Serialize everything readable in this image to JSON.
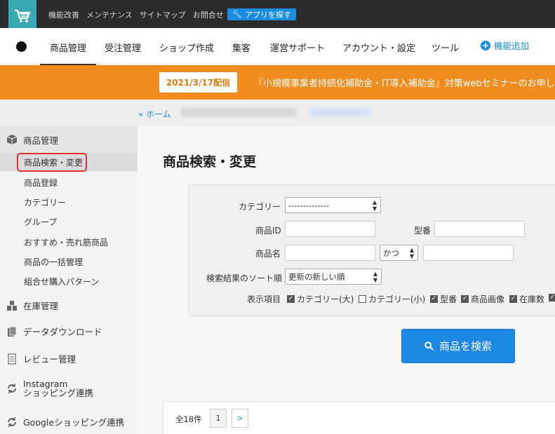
{
  "topbar": {
    "links": [
      "機能改善",
      "メンテナンス",
      "サイトマップ",
      "お問合せ"
    ],
    "app_button": "アプリを探す"
  },
  "mainnav": {
    "items": [
      "商品管理",
      "受注管理",
      "ショップ作成",
      "集客",
      "運営サポート",
      "アカウント・設定",
      "ツール"
    ],
    "add_label": "機能追加"
  },
  "banner": {
    "date": "2021/3/17配信",
    "text": "『小規模事業者持続化補助金・IT導入補助金』対策webセミナーのお申し込"
  },
  "breadcrumb": {
    "home": "« ホーム"
  },
  "sidebar": {
    "product_header": "商品管理",
    "product_items": [
      "商品検索・変更",
      "商品登録",
      "カテゴリー",
      "グループ",
      "おすすめ・売れ筋商品",
      "商品の一括管理",
      "組合せ購入パターン"
    ],
    "sections": [
      "在庫管理",
      "データダウンロード",
      "レビュー管理",
      "Instagram",
      "ショッピング連携",
      "Googleショッピング連携"
    ]
  },
  "page": {
    "title": "商品検索・変更"
  },
  "form": {
    "category_label": "カテゴリー",
    "category_value": "--------------",
    "product_id_label": "商品ID",
    "model_label": "型番",
    "name_label": "商品名",
    "name_op": "かつ",
    "sort_label": "検索結果のソート順",
    "sort_value": "更新の新しい順",
    "display_label": "表示項目",
    "display_items": [
      {
        "label": "カテゴリー(大)",
        "checked": true
      },
      {
        "label": "カテゴリー(小)",
        "checked": false
      },
      {
        "label": "型番",
        "checked": true
      },
      {
        "label": "商品画像",
        "checked": true
      },
      {
        "label": "在庫数",
        "checked": true
      }
    ],
    "search_button": "商品を検索"
  },
  "results": {
    "count": "全18件",
    "page": "1",
    "next": ">"
  }
}
